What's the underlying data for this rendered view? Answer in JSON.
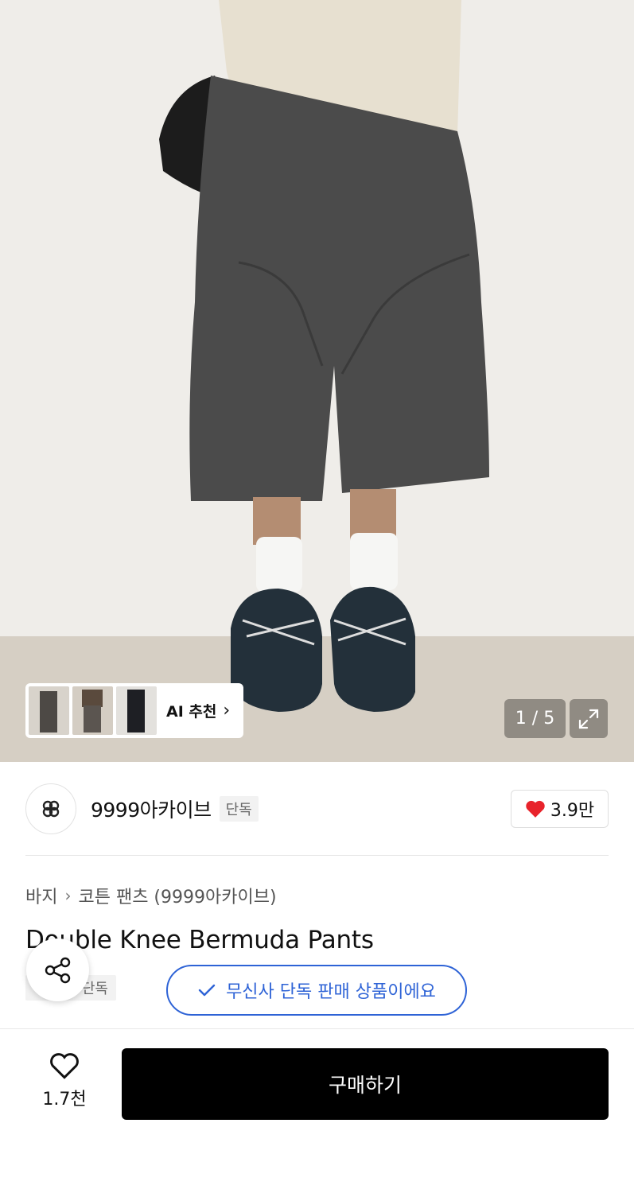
{
  "product_image": {
    "counter": "1 / 5",
    "ai_recommend": {
      "label": "AI 추천",
      "chevron": "chevron-right-icon"
    },
    "expand_icon": "expand-icon"
  },
  "brand": {
    "name": "9999아카이브",
    "tag": "단독",
    "likes": "3.9만",
    "like_icon": "heart-filled-icon",
    "like_color": "#e8232b"
  },
  "breadcrumb": {
    "items": [
      "바지",
      "코튼 팬츠 (9999아카이브)"
    ]
  },
  "product": {
    "title": "Double Knee Bermuda Pants",
    "tag": "단독",
    "exclusive_notice": "무신사 단독 판매 상품이에요",
    "accent_color": "#2e63d6"
  },
  "bottom_bar": {
    "wish_count": "1.7천",
    "buy_label": "구매하기"
  }
}
